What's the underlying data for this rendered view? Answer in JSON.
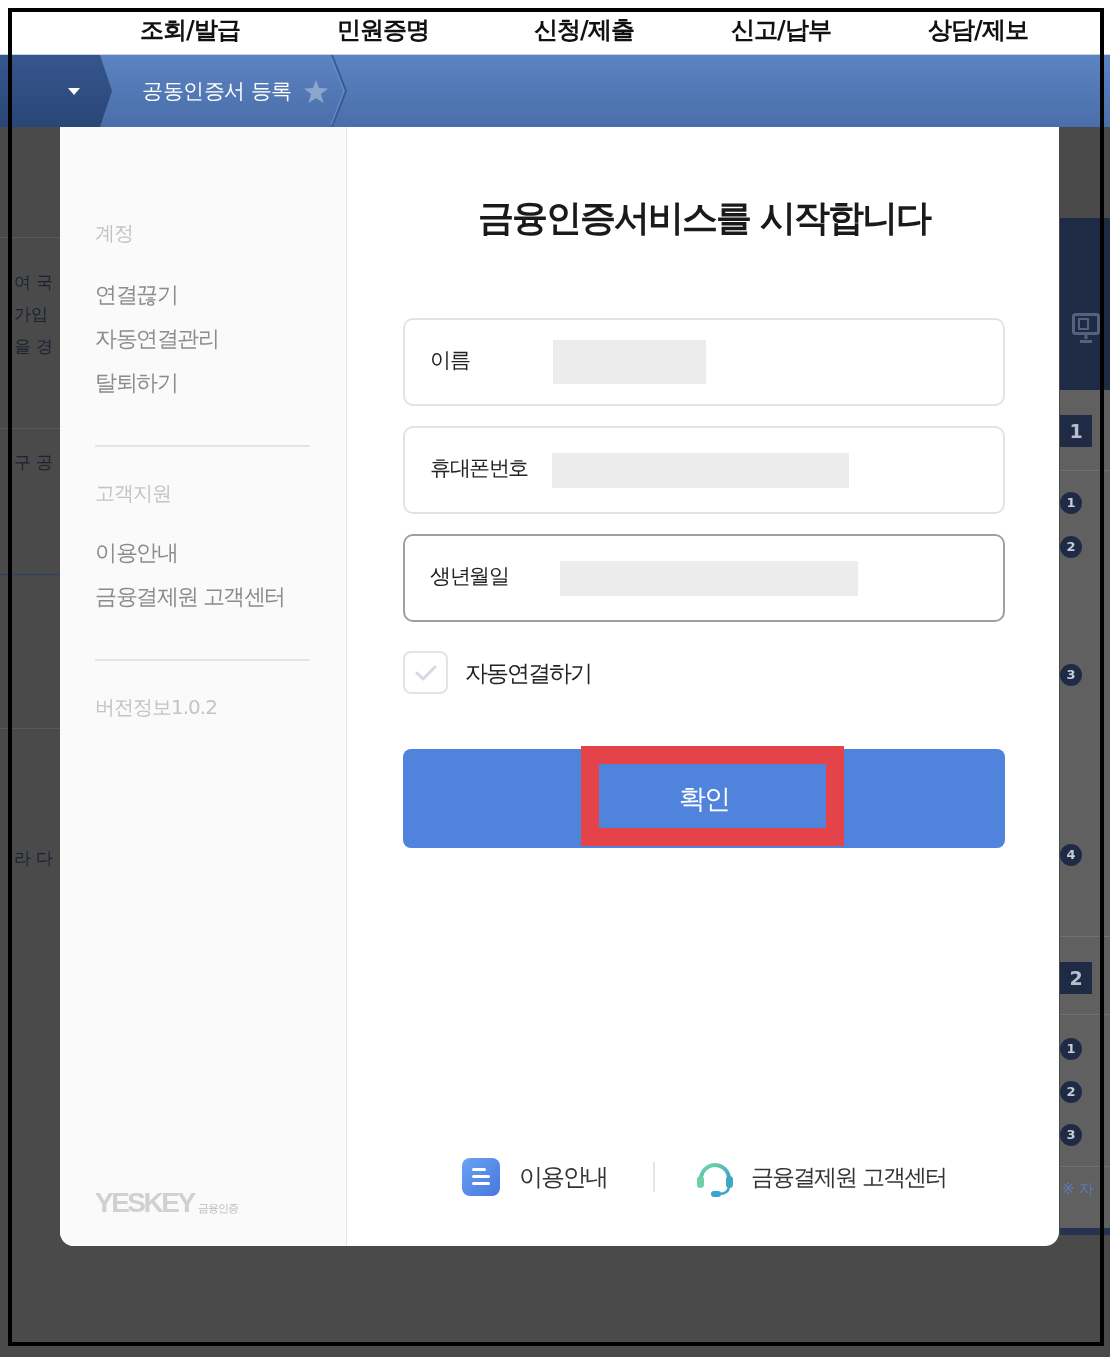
{
  "top_menu": [
    "조회/발급",
    "민원증명",
    "신청/제출",
    "신고/납부",
    "상담/제보"
  ],
  "breadcrumb": {
    "title": "공동인증서 등록",
    "favorite": false
  },
  "background_left": [
    "여 국",
    "가입",
    "을 경",
    "구 공",
    "라 다"
  ],
  "background_right": {
    "steps": [
      {
        "number": "1",
        "items": [
          "1",
          "2",
          "3",
          "4"
        ]
      },
      {
        "number": "2",
        "items": [
          "1",
          "2",
          "3"
        ]
      }
    ],
    "note": "※ 자"
  },
  "sidebar": {
    "sections": [
      {
        "heading": "계정",
        "items": [
          "연결끊기",
          "자동연결관리",
          "탈퇴하기"
        ]
      },
      {
        "heading": "고객지원",
        "items": [
          "이용안내",
          "금융결제원 고객센터"
        ]
      }
    ],
    "version": "버전정보1.0.2",
    "logo": {
      "wordmark": "YESKEY",
      "tagline": "금융인증"
    }
  },
  "dialog": {
    "title": "금융인증서비스를 시작합니다",
    "fields": [
      {
        "label": "이름",
        "value_redacted": true,
        "focused": false
      },
      {
        "label": "휴대폰번호",
        "value_redacted": true,
        "focused": false
      },
      {
        "label": "생년월일",
        "value_redacted": true,
        "focused": true
      }
    ],
    "auto_connect": {
      "label": "자동연결하기",
      "checked": false
    },
    "confirm_button": {
      "label": "확인",
      "highlighted": true
    },
    "footer_links": [
      {
        "kind": "guide",
        "label": "이용안내"
      },
      {
        "kind": "support",
        "label": "금융결제원 고객센터"
      }
    ]
  }
}
